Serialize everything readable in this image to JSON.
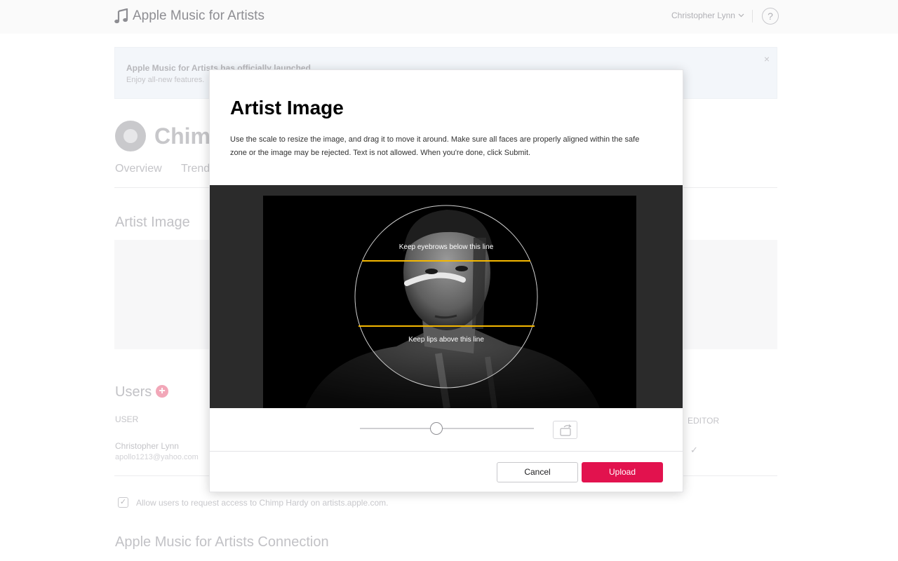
{
  "app": {
    "title": "Apple Music for Artists",
    "user_name": "Christopher Lynn",
    "help_label": "?"
  },
  "banner": {
    "title": "Apple Music for Artists has officially launched.",
    "subtitle": "Enjoy all-new features.",
    "close_label": "×"
  },
  "artist": {
    "name": "Chimp Hardy",
    "tabs": [
      "Overview",
      "Trends"
    ]
  },
  "sections": {
    "artist_image": "Artist Image",
    "users": "Users",
    "users_add_label": "+",
    "connection": "Apple Music for Artists Connection"
  },
  "users_table": {
    "col_user": "USER",
    "col_editor": "EDITOR",
    "rows": [
      {
        "name": "Christopher Lynn",
        "email": "apollo1213@yahoo.com",
        "editor": "✓"
      }
    ]
  },
  "allow_request": {
    "checked_glyph": "✓",
    "label": "Allow users to request access to Chimp Hardy on artists.apple.com."
  },
  "modal": {
    "title": "Artist Image",
    "description": "Use the scale to resize the image, and drag it to move it around. Make sure all faces are properly aligned within the safe zone or the image may be rejected. Text is not allowed. When you're done, click Submit.",
    "hint_top": "Keep eyebrows below this line",
    "hint_bottom": "Keep lips above this line",
    "zoom_level": 0.44,
    "cancel_label": "Cancel",
    "upload_label": "Upload",
    "rotate_icon": "rotate-icon"
  },
  "colors": {
    "accent": "#e2124e",
    "guide_line": "#f5b800"
  }
}
